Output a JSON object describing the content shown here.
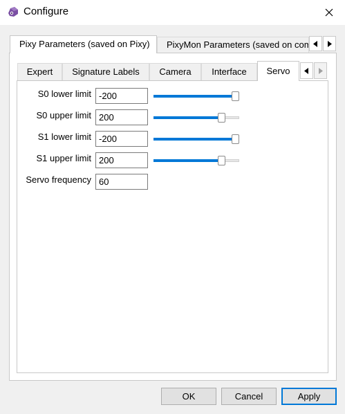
{
  "window": {
    "title": "Configure",
    "app_icon": "pixy-icon",
    "close_icon": "close-icon"
  },
  "outer_tabs": [
    {
      "label": "Pixy Parameters (saved on Pixy)",
      "selected": true
    },
    {
      "label": "PixyMon Parameters (saved on computer)",
      "selected": false
    }
  ],
  "inner_tabs": [
    {
      "label": "Expert",
      "selected": false
    },
    {
      "label": "Signature Labels",
      "selected": false
    },
    {
      "label": "Camera",
      "selected": false
    },
    {
      "label": "Interface",
      "selected": false
    },
    {
      "label": "Servo",
      "selected": true
    }
  ],
  "parameters": [
    {
      "label": "S0 lower limit",
      "value": "-200",
      "slider_fraction": 1.0
    },
    {
      "label": "S0 upper limit",
      "value": "200",
      "slider_fraction": 0.82
    },
    {
      "label": "S1 lower limit",
      "value": "-200",
      "slider_fraction": 1.0
    },
    {
      "label": "S1 upper limit",
      "value": "200",
      "slider_fraction": 0.82
    },
    {
      "label": "Servo frequency",
      "value": "60"
    }
  ],
  "buttons": {
    "ok": "OK",
    "cancel": "Cancel",
    "apply": "Apply"
  },
  "colors": {
    "accent": "#0078d7",
    "app_icon": "#7a4fa3"
  }
}
